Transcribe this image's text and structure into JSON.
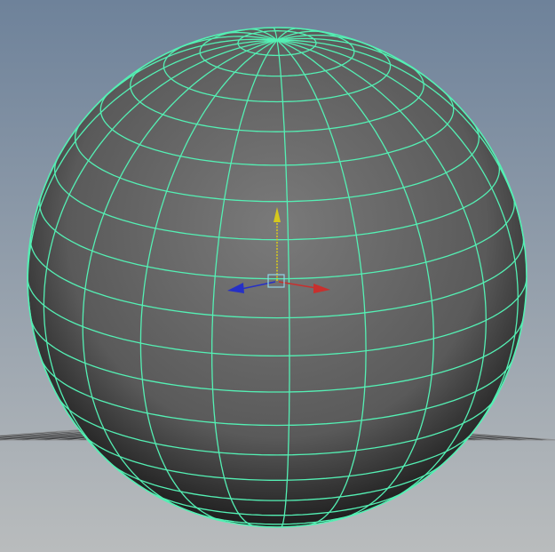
{
  "viewport": {
    "background_top": "#6e829a",
    "background_bottom": "#b9bcbd",
    "ground_grid": {
      "visible": true,
      "fill": "#3a3b3d",
      "line_color": "#8e9092",
      "axis_color": "#0d0d0d"
    }
  },
  "object": {
    "type": "polySphere",
    "selected": true,
    "subdivisions_axis": 20,
    "subdivisions_height": 20,
    "wireframe_color": "#54f0b4",
    "shade_light": "#7a7a7a",
    "shade_dark": "#1e1e1e"
  },
  "manipulator": {
    "type": "move-tool",
    "x_axis_color": "#c8302e",
    "y_axis_color": "#d6c81c",
    "z_axis_color": "#2630c6",
    "center_handle_color": "#8fd8e8"
  }
}
